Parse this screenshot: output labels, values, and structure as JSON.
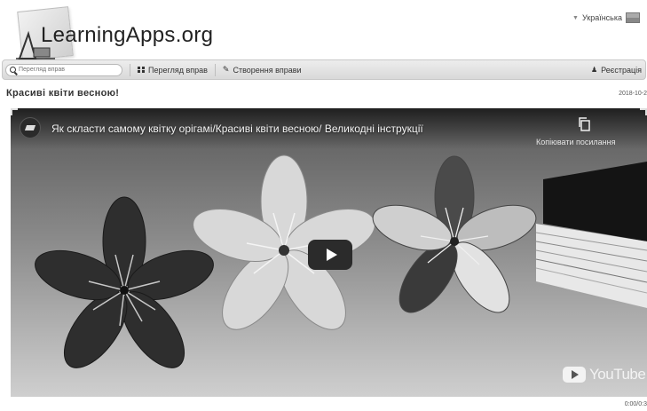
{
  "header": {
    "logo_text": "LearningApps.org",
    "language": "Українська"
  },
  "navbar": {
    "search_placeholder": "Перегляд вправ",
    "browse_label": "Перегляд вправ",
    "create_label": "Створення вправи",
    "register_label": "Реєстрація"
  },
  "page": {
    "title": "Красиві квіти весною!",
    "date": "2018-10-2"
  },
  "video": {
    "title": "Як скласти самому квітку орігамі/Красиві квіти весною/ Великодні інструкції",
    "copy_link_label": "Копіювати посилання",
    "brand": "YouTube",
    "timer": "0:00/0:3"
  }
}
